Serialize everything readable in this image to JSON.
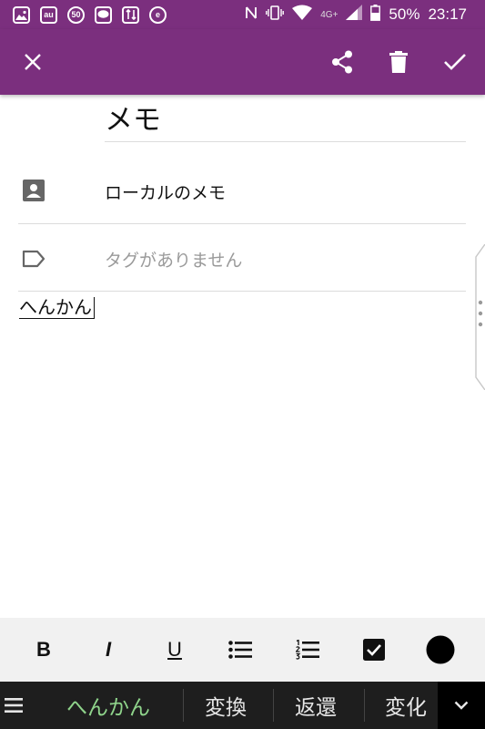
{
  "status_bar": {
    "au_label": "au",
    "num_label": "50",
    "e_label": "e",
    "network": "4G+",
    "battery": "50%",
    "time": "23:17"
  },
  "toolbar": {
    "close_icon": "close-icon",
    "share_icon": "share-icon",
    "delete_icon": "trash-icon",
    "save_icon": "check-icon"
  },
  "note": {
    "title": "メモ",
    "notebook": "ローカルのメモ",
    "tags_placeholder": "タグがありません",
    "body": "へんかん"
  },
  "format_bar": {
    "bold": "B",
    "italic": "I",
    "underline": "U"
  },
  "ime": {
    "candidates": [
      "へんかん",
      "変換",
      "返還",
      "変化"
    ]
  },
  "colors": {
    "accent": "#7b2f7e",
    "candidate_active": "#8fd48b"
  }
}
